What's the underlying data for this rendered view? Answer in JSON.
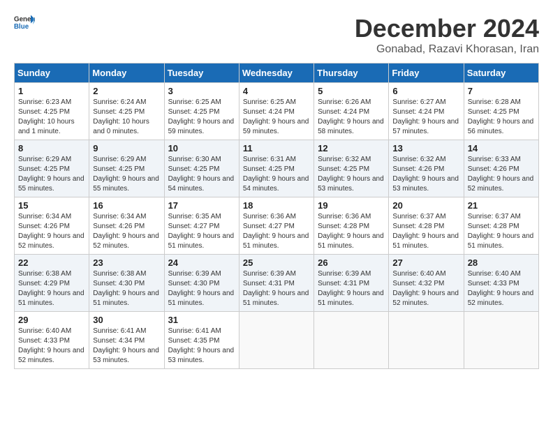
{
  "header": {
    "logo": {
      "general": "General",
      "blue": "Blue"
    },
    "title": "December 2024",
    "location": "Gonabad, Razavi Khorasan, Iran"
  },
  "weekdays": [
    "Sunday",
    "Monday",
    "Tuesday",
    "Wednesday",
    "Thursday",
    "Friday",
    "Saturday"
  ],
  "weeks": [
    [
      {
        "day": "1",
        "sunrise": "6:23 AM",
        "sunset": "4:25 PM",
        "daylight": "10 hours and 1 minute."
      },
      {
        "day": "2",
        "sunrise": "6:24 AM",
        "sunset": "4:25 PM",
        "daylight": "10 hours and 0 minutes."
      },
      {
        "day": "3",
        "sunrise": "6:25 AM",
        "sunset": "4:25 PM",
        "daylight": "9 hours and 59 minutes."
      },
      {
        "day": "4",
        "sunrise": "6:25 AM",
        "sunset": "4:24 PM",
        "daylight": "9 hours and 59 minutes."
      },
      {
        "day": "5",
        "sunrise": "6:26 AM",
        "sunset": "4:24 PM",
        "daylight": "9 hours and 58 minutes."
      },
      {
        "day": "6",
        "sunrise": "6:27 AM",
        "sunset": "4:24 PM",
        "daylight": "9 hours and 57 minutes."
      },
      {
        "day": "7",
        "sunrise": "6:28 AM",
        "sunset": "4:25 PM",
        "daylight": "9 hours and 56 minutes."
      }
    ],
    [
      {
        "day": "8",
        "sunrise": "6:29 AM",
        "sunset": "4:25 PM",
        "daylight": "9 hours and 55 minutes."
      },
      {
        "day": "9",
        "sunrise": "6:29 AM",
        "sunset": "4:25 PM",
        "daylight": "9 hours and 55 minutes."
      },
      {
        "day": "10",
        "sunrise": "6:30 AM",
        "sunset": "4:25 PM",
        "daylight": "9 hours and 54 minutes."
      },
      {
        "day": "11",
        "sunrise": "6:31 AM",
        "sunset": "4:25 PM",
        "daylight": "9 hours and 54 minutes."
      },
      {
        "day": "12",
        "sunrise": "6:32 AM",
        "sunset": "4:25 PM",
        "daylight": "9 hours and 53 minutes."
      },
      {
        "day": "13",
        "sunrise": "6:32 AM",
        "sunset": "4:26 PM",
        "daylight": "9 hours and 53 minutes."
      },
      {
        "day": "14",
        "sunrise": "6:33 AM",
        "sunset": "4:26 PM",
        "daylight": "9 hours and 52 minutes."
      }
    ],
    [
      {
        "day": "15",
        "sunrise": "6:34 AM",
        "sunset": "4:26 PM",
        "daylight": "9 hours and 52 minutes."
      },
      {
        "day": "16",
        "sunrise": "6:34 AM",
        "sunset": "4:26 PM",
        "daylight": "9 hours and 52 minutes."
      },
      {
        "day": "17",
        "sunrise": "6:35 AM",
        "sunset": "4:27 PM",
        "daylight": "9 hours and 51 minutes."
      },
      {
        "day": "18",
        "sunrise": "6:36 AM",
        "sunset": "4:27 PM",
        "daylight": "9 hours and 51 minutes."
      },
      {
        "day": "19",
        "sunrise": "6:36 AM",
        "sunset": "4:28 PM",
        "daylight": "9 hours and 51 minutes."
      },
      {
        "day": "20",
        "sunrise": "6:37 AM",
        "sunset": "4:28 PM",
        "daylight": "9 hours and 51 minutes."
      },
      {
        "day": "21",
        "sunrise": "6:37 AM",
        "sunset": "4:28 PM",
        "daylight": "9 hours and 51 minutes."
      }
    ],
    [
      {
        "day": "22",
        "sunrise": "6:38 AM",
        "sunset": "4:29 PM",
        "daylight": "9 hours and 51 minutes."
      },
      {
        "day": "23",
        "sunrise": "6:38 AM",
        "sunset": "4:30 PM",
        "daylight": "9 hours and 51 minutes."
      },
      {
        "day": "24",
        "sunrise": "6:39 AM",
        "sunset": "4:30 PM",
        "daylight": "9 hours and 51 minutes."
      },
      {
        "day": "25",
        "sunrise": "6:39 AM",
        "sunset": "4:31 PM",
        "daylight": "9 hours and 51 minutes."
      },
      {
        "day": "26",
        "sunrise": "6:39 AM",
        "sunset": "4:31 PM",
        "daylight": "9 hours and 51 minutes."
      },
      {
        "day": "27",
        "sunrise": "6:40 AM",
        "sunset": "4:32 PM",
        "daylight": "9 hours and 52 minutes."
      },
      {
        "day": "28",
        "sunrise": "6:40 AM",
        "sunset": "4:33 PM",
        "daylight": "9 hours and 52 minutes."
      }
    ],
    [
      {
        "day": "29",
        "sunrise": "6:40 AM",
        "sunset": "4:33 PM",
        "daylight": "9 hours and 52 minutes."
      },
      {
        "day": "30",
        "sunrise": "6:41 AM",
        "sunset": "4:34 PM",
        "daylight": "9 hours and 53 minutes."
      },
      {
        "day": "31",
        "sunrise": "6:41 AM",
        "sunset": "4:35 PM",
        "daylight": "9 hours and 53 minutes."
      },
      null,
      null,
      null,
      null
    ]
  ]
}
